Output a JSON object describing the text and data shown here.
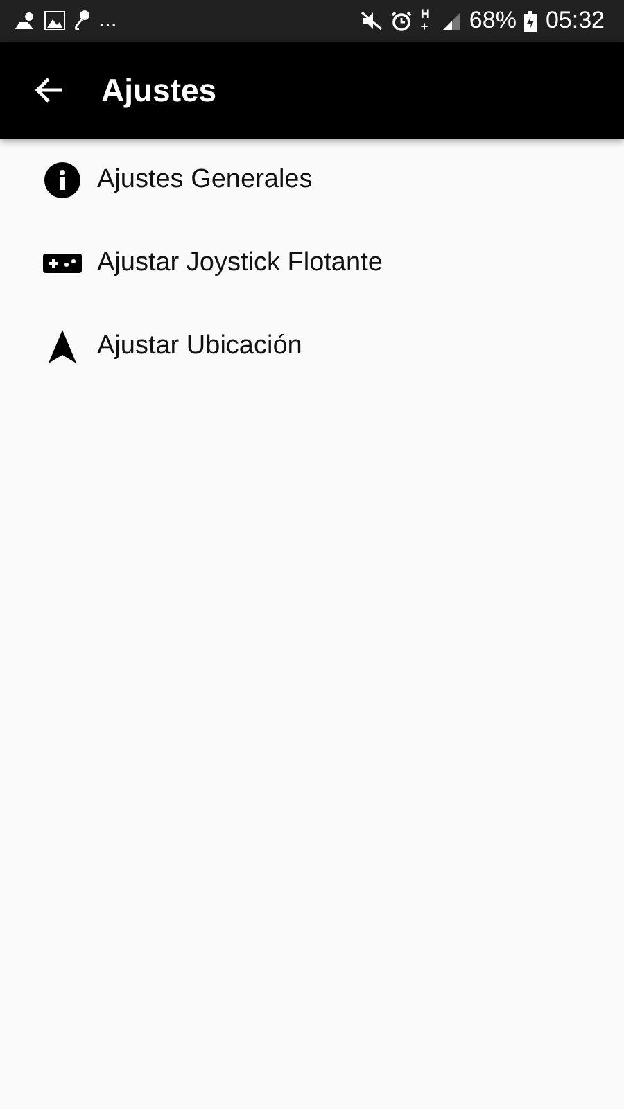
{
  "status_bar": {
    "overflow": "...",
    "network": "H+",
    "battery": "68%",
    "time": "05:32"
  },
  "app_bar": {
    "title": "Ajustes"
  },
  "menu": [
    {
      "label": "Ajustes Generales"
    },
    {
      "label": "Ajustar Joystick Flotante"
    },
    {
      "label": "Ajustar Ubicación"
    }
  ]
}
